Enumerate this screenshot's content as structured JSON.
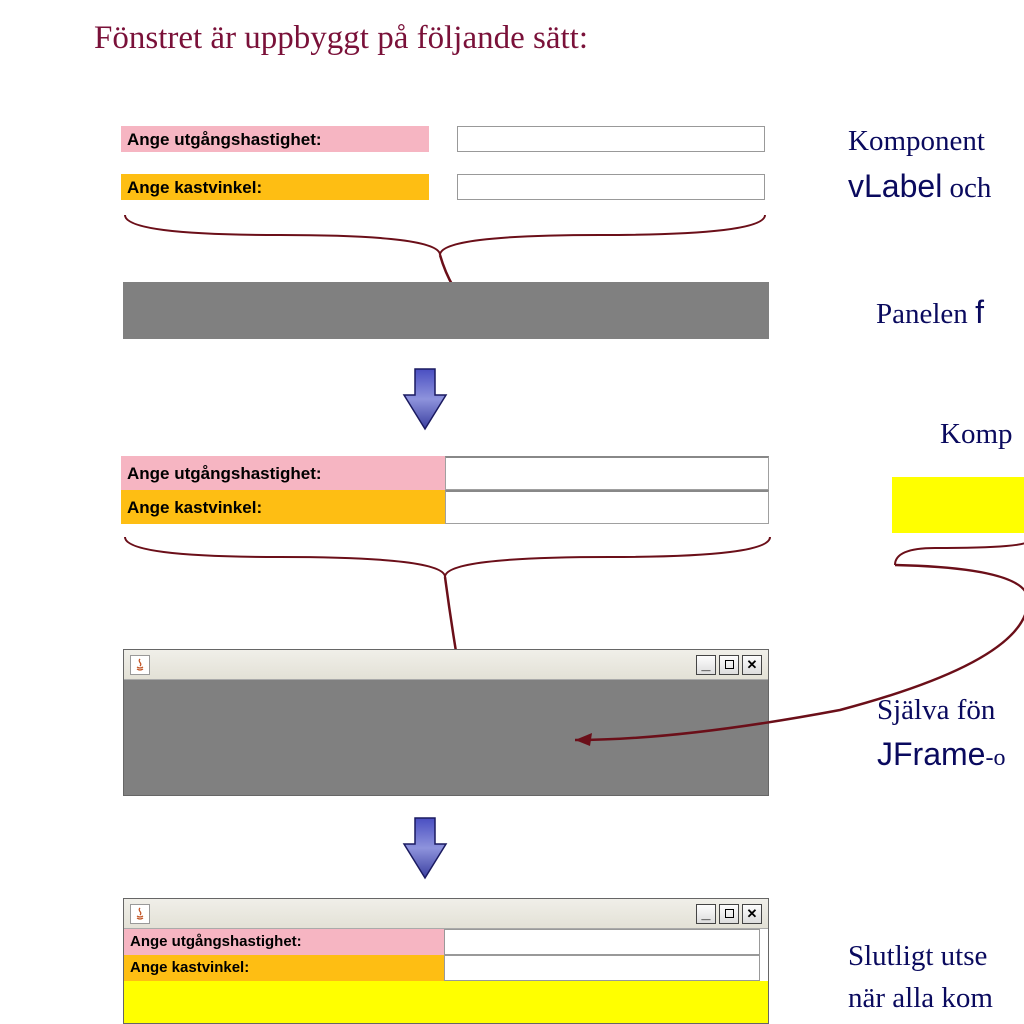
{
  "title": "Fönstret är uppbyggt på följande sätt:",
  "labels": {
    "speed": "Ange utgångshastighet:",
    "angle": "Ange kastvinkel:"
  },
  "right": {
    "line1a": "Komponent",
    "line1b": "vLabel",
    "line1c": " och",
    "line2a": "Panelen ",
    "line2b": "f",
    "line3": "Komp",
    "line4a": "Själva fön",
    "line4b": "JFrame",
    "line4c": "-o",
    "line5a": "Slutligt utse",
    "line5b": "när alla kom"
  },
  "winbtns": {
    "min": "–",
    "max": "□",
    "close": "✕"
  }
}
